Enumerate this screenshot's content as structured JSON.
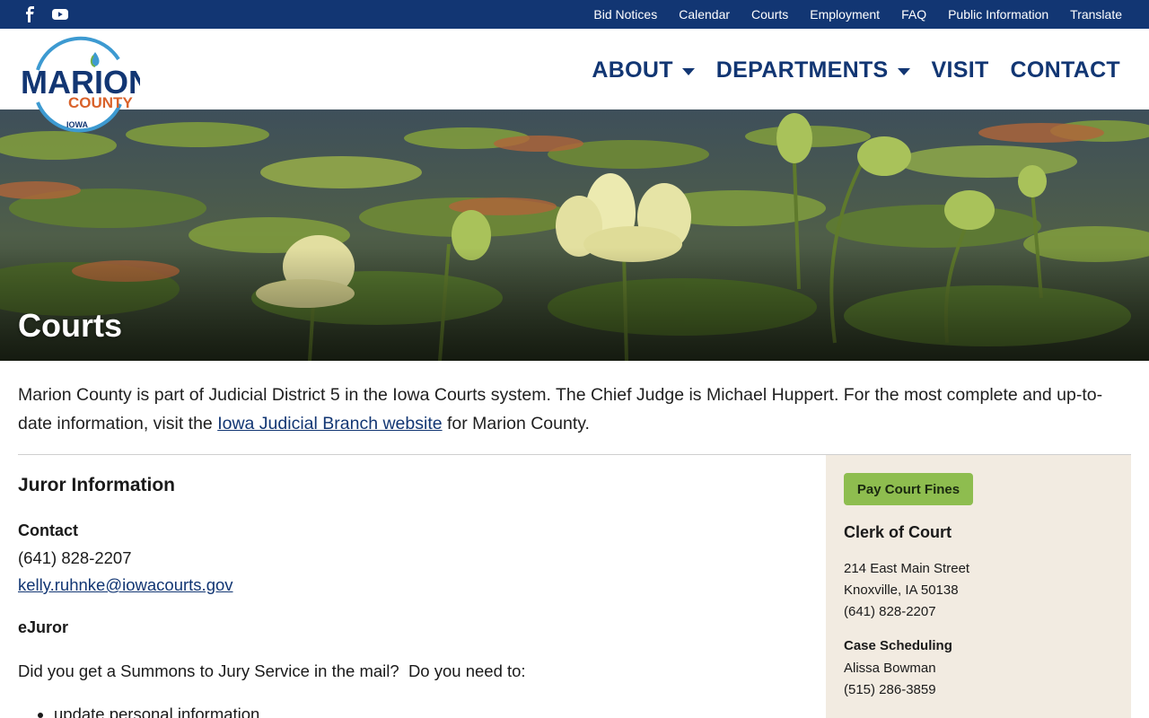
{
  "topbar": {
    "social": [
      {
        "icon": "facebook-icon"
      },
      {
        "icon": "youtube-icon"
      }
    ],
    "links": [
      "Bid Notices",
      "Calendar",
      "Courts",
      "Employment",
      "FAQ",
      "Public Information",
      "Translate"
    ]
  },
  "logo": {
    "line1": "MARION",
    "line2": "COUNTY",
    "line3": "IOWA"
  },
  "nav": {
    "about": "ABOUT",
    "departments": "DEPARTMENTS",
    "visit": "VISIT",
    "contact": "CONTACT"
  },
  "hero": {
    "title": "Courts"
  },
  "intro": {
    "before": "Marion County is part of Judicial District 5 in the Iowa Courts system. The Chief Judge is Michael Huppert. For the most complete and up-to-date information, visit the ",
    "link": "Iowa Judicial Branch website",
    "after": " for Marion County."
  },
  "juror": {
    "heading": "Juror Information",
    "contact_label": "Contact",
    "phone": "(641) 828-2207",
    "email": "kelly.ruhnke@iowacourts.gov",
    "ejuror_label": "eJuror",
    "summons_text": "Did you get a Summons to Jury Service in the mail?  Do you need to:",
    "bullets": [
      "update personal information"
    ]
  },
  "sidebar": {
    "pay_button": "Pay Court Fines",
    "clerk_title": "Clerk of Court",
    "address1": "214 East Main Street",
    "address2": "Knoxville, IA  50138",
    "phone": "(641) 828-2207",
    "scheduling_title": "Case Scheduling",
    "scheduling_name": "Alissa Bowman",
    "scheduling_phone": "(515) 286-3859"
  },
  "colors": {
    "navy": "#123673",
    "pay_button": "#8ebd4f",
    "sidebar_bg": "#f2ebe1",
    "logo_orange": "#d9622b",
    "logo_blue_ring": "#3d9ad1"
  }
}
